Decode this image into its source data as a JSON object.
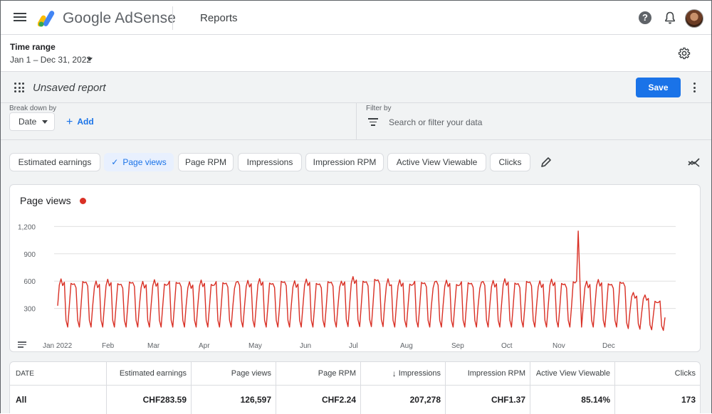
{
  "topbar": {
    "brand": "Google AdSense",
    "section": "Reports",
    "icons": [
      "menu-icon",
      "adsense-logo",
      "help-icon",
      "bell-icon",
      "avatar"
    ]
  },
  "time_range": {
    "label": "Time range",
    "value": "Jan 1 – Dec 31, 2022"
  },
  "report": {
    "name": "Unsaved report",
    "save_label": "Save",
    "breakdown_label": "Break down by",
    "breakdown_value": "Date",
    "add_label": "Add",
    "filter_label": "Filter by",
    "filter_placeholder": "Search or filter your data"
  },
  "metric_chips": [
    {
      "label": "Estimated earnings",
      "active": false
    },
    {
      "label": "Page views",
      "active": true
    },
    {
      "label": "Page RPM",
      "active": false
    },
    {
      "label": "Impressions",
      "active": false
    },
    {
      "label": "Impression RPM",
      "active": false
    },
    {
      "label": "Active View Viewable",
      "active": false
    },
    {
      "label": "Clicks",
      "active": false
    }
  ],
  "colors": {
    "accent": "#1a73e8",
    "series": "#d93025"
  },
  "chart_data": {
    "type": "line",
    "title": "Page views",
    "series_name": "Page views",
    "yticks": [
      300,
      600,
      900,
      1200
    ],
    "ylim": [
      0,
      1250
    ],
    "xticks": [
      "Jan 2022",
      "Feb",
      "Mar",
      "Apr",
      "May",
      "Jun",
      "Jul",
      "Aug",
      "Sep",
      "Oct",
      "Nov",
      "Dec"
    ],
    "grid": true,
    "weekly_pattern": {
      "weekday_peak_approx": 580,
      "weekend_low_approx": 90
    },
    "peak": {
      "month": "Nov",
      "value_approx": 1150
    }
  },
  "table": {
    "headers": [
      "DATE",
      "Estimated earnings",
      "Page views",
      "Page RPM",
      "Impressions",
      "Impression RPM",
      "Active View Viewable",
      "Clicks"
    ],
    "sorted_column": "Impressions",
    "total_row": [
      "All",
      "CHF283.59",
      "126,597",
      "CHF2.24",
      "207,278",
      "CHF1.37",
      "85.14%",
      "173"
    ]
  }
}
